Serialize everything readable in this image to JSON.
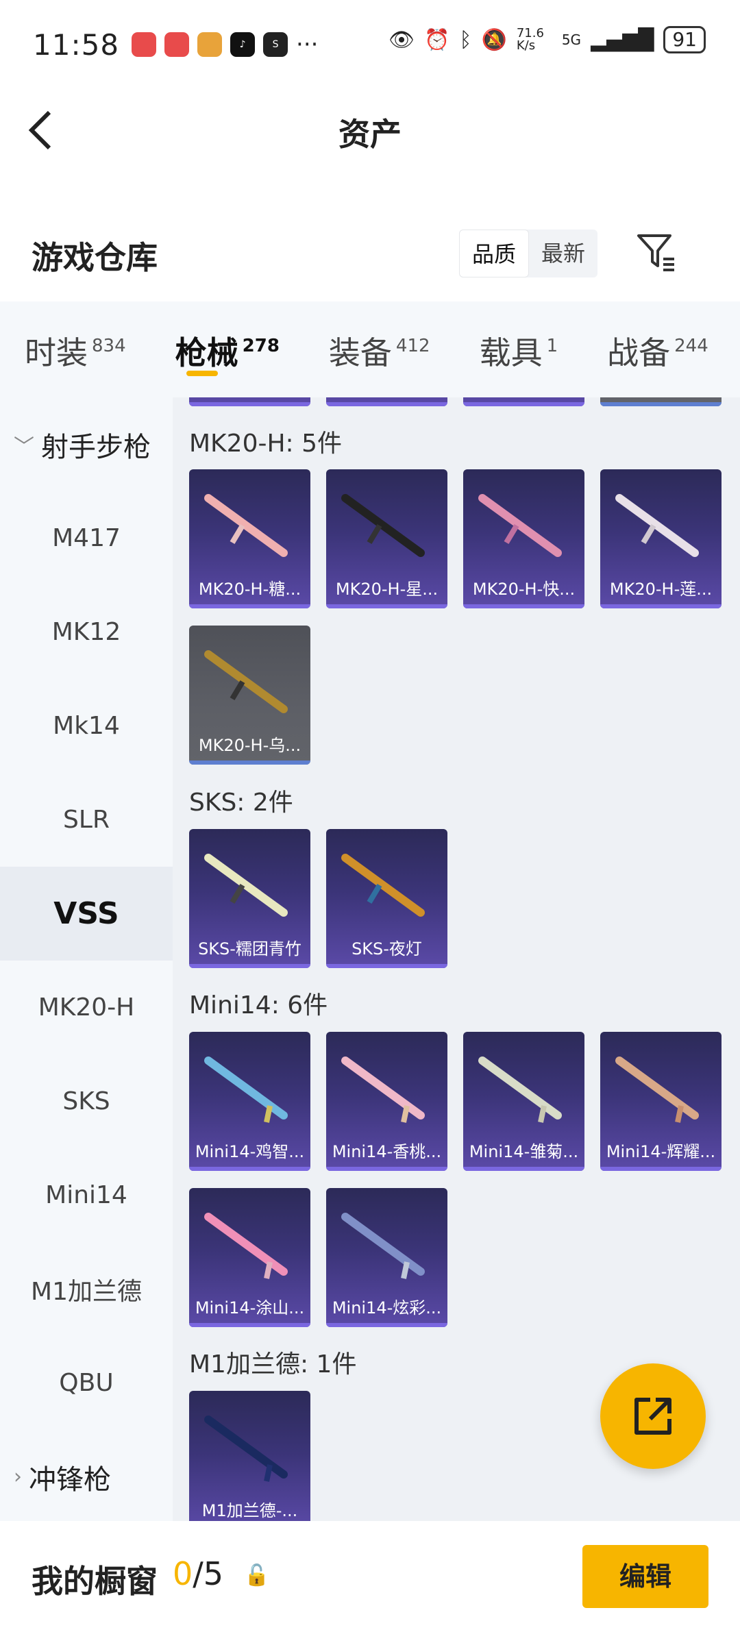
{
  "status_bar": {
    "time": "11:58",
    "more": "···",
    "speed": "71.6 K/s",
    "network": "5G",
    "battery": "91"
  },
  "header": {
    "back_icon": "chevron-left-icon",
    "title": "资产"
  },
  "warehouse": {
    "title": "游戏仓库",
    "sort_options": [
      "品质",
      "最新"
    ],
    "selected_sort": "品质"
  },
  "tabs": [
    {
      "label": "时装",
      "count": "834"
    },
    {
      "label": "枪械",
      "count": "278"
    },
    {
      "label": "装备",
      "count": "412"
    },
    {
      "label": "载具",
      "count": "1"
    },
    {
      "label": "战备",
      "count": "244"
    }
  ],
  "active_tab": "枪械",
  "sidebar": {
    "items": [
      "射手步枪",
      "M417",
      "MK12",
      "Mk14",
      "SLR",
      "VSS",
      "MK20-H",
      "SKS",
      "Mini14",
      "M1加兰德",
      "QBU",
      "冲锋枪"
    ],
    "active": "VSS"
  },
  "sections": [
    {
      "title": "MK20-H: 5件",
      "items": [
        "MK20-H-糖...",
        "MK20-H-星...",
        "MK20-H-快...",
        "MK20-H-莲...",
        "MK20-H-乌..."
      ]
    },
    {
      "title": "SKS: 2件",
      "items": [
        "SKS-糯团青竹",
        "SKS-夜灯"
      ]
    },
    {
      "title": "Mini14: 6件",
      "items": [
        "Mini14-鸡智...",
        "Mini14-香桃...",
        "Mini14-雏菊...",
        "Mini14-辉耀...",
        "Mini14-涂山...",
        "Mini14-炫彩..."
      ]
    },
    {
      "title": "M1加兰德: 1件",
      "items": [
        "M1加兰德-..."
      ]
    }
  ],
  "showcase": {
    "label": "我的橱窗",
    "current": "0",
    "total": "/5",
    "edit_label": "编辑"
  },
  "colors": {
    "accent": "#f7b500",
    "card_purple": "#3b3478",
    "card_grey": "#5d5f66"
  }
}
